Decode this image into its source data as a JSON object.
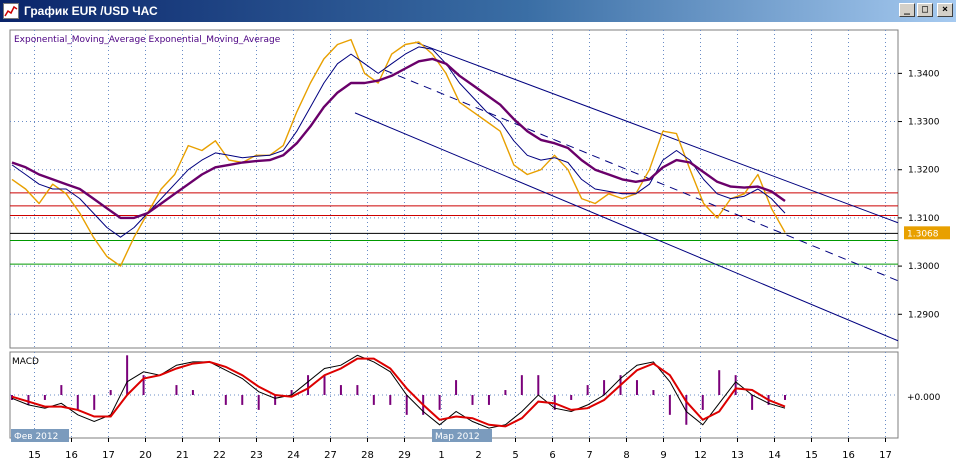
{
  "window": {
    "title": "График EUR /USD  ЧАС",
    "minimize_glyph": "_",
    "maximize_glyph": "□",
    "close_glyph": "×"
  },
  "indicators": {
    "legend": "Exponential_Moving_Average  Exponential_Moving_Average",
    "macd_label": "MACD",
    "macd_zero_label": "+0.000"
  },
  "current_price_label": "1.3068",
  "month_labels": [
    "Фев 2012",
    "Мар 2012"
  ],
  "colors": {
    "price": "#e8a000",
    "ema_fast": "#00007f",
    "ema_slow": "#6a006a",
    "channel": "#00007f",
    "resistance": "#cc0000",
    "support": "#009900",
    "current_line": "#000000",
    "macd_main": "#000000",
    "macd_signal": "#dd0000",
    "macd_hist": "#7a007a",
    "grid": "#6a8cc6"
  },
  "chart_data": {
    "type": "line",
    "y_tick_labels": [
      "1.3400",
      "1.3300",
      "1.3200",
      "1.3100",
      "1.3000",
      "1.2900"
    ],
    "y_ticks": [
      1.34,
      1.33,
      1.32,
      1.31,
      1.3,
      1.29
    ],
    "ylim": [
      1.283,
      1.349
    ],
    "x_tick_labels": [
      "15",
      "16",
      "17",
      "20",
      "21",
      "22",
      "23",
      "24",
      "27",
      "28",
      "29",
      "1",
      "2",
      "5",
      "6",
      "7",
      "8",
      "9",
      "12",
      "13",
      "14",
      "15",
      "16",
      "17"
    ],
    "horizontal_levels": {
      "resistance": [
        1.3152,
        1.3125,
        1.3105
      ],
      "current": 1.3068,
      "support": [
        1.3053,
        1.3004
      ]
    },
    "series": [
      {
        "values": [
          1.318,
          1.316,
          1.313,
          1.317,
          1.315,
          1.311,
          1.306,
          1.302,
          1.3,
          1.306,
          1.311,
          1.316,
          1.319,
          1.325,
          1.324,
          1.326,
          1.322,
          1.3215,
          1.323,
          1.323,
          1.325,
          1.332,
          1.338,
          1.343,
          1.346,
          1.347,
          1.34,
          1.338,
          1.344,
          1.346,
          1.3465,
          1.344,
          1.34,
          1.334,
          1.332,
          1.33,
          1.328,
          1.321,
          1.319,
          1.32,
          1.323,
          1.32,
          1.314,
          1.313,
          1.315,
          1.314,
          1.315,
          1.32,
          1.328,
          1.3275,
          1.32,
          1.313,
          1.31,
          1.314,
          1.315,
          1.319,
          1.312,
          1.307
        ]
      },
      {
        "values": [
          1.321,
          1.319,
          1.317,
          1.316,
          1.316,
          1.314,
          1.311,
          1.308,
          1.306,
          1.308,
          1.311,
          1.314,
          1.317,
          1.32,
          1.322,
          1.3235,
          1.323,
          1.3225,
          1.3228,
          1.323,
          1.324,
          1.328,
          1.333,
          1.338,
          1.342,
          1.344,
          1.342,
          1.34,
          1.342,
          1.344,
          1.3455,
          1.345,
          1.342,
          1.338,
          1.335,
          1.332,
          1.33,
          1.326,
          1.323,
          1.322,
          1.3225,
          1.3215,
          1.318,
          1.316,
          1.3155,
          1.315,
          1.315,
          1.317,
          1.322,
          1.324,
          1.322,
          1.318,
          1.315,
          1.314,
          1.3145,
          1.316,
          1.314,
          1.311
        ]
      },
      {
        "values": [
          1.3215,
          1.3205,
          1.319,
          1.318,
          1.317,
          1.316,
          1.314,
          1.312,
          1.31,
          1.31,
          1.311,
          1.313,
          1.315,
          1.317,
          1.319,
          1.3205,
          1.321,
          1.3215,
          1.3218,
          1.322,
          1.323,
          1.3255,
          1.329,
          1.333,
          1.336,
          1.338,
          1.338,
          1.3385,
          1.3395,
          1.341,
          1.3425,
          1.343,
          1.342,
          1.3395,
          1.3375,
          1.3355,
          1.3335,
          1.3305,
          1.328,
          1.3262,
          1.3255,
          1.3245,
          1.322,
          1.32,
          1.319,
          1.318,
          1.3175,
          1.318,
          1.3205,
          1.322,
          1.3215,
          1.3195,
          1.3175,
          1.3165,
          1.3163,
          1.3165,
          1.3155,
          1.3135
        ]
      }
    ],
    "channel_upper": [
      [
        1.3465,
        1.309
      ]
    ],
    "channel_lower": [
      [
        1.3318,
        1.2845
      ]
    ],
    "macd_main": [
      -0.0002,
      -0.0006,
      -0.0008,
      -0.0005,
      -0.0012,
      -0.0016,
      -0.0012,
      0.0008,
      0.0014,
      0.0012,
      0.0018,
      0.002,
      0.002,
      0.0015,
      0.001,
      0.0002,
      -0.0002,
      0.0,
      0.0008,
      0.0016,
      0.0018,
      0.0024,
      0.002,
      0.0014,
      0.0,
      -0.001,
      -0.0018,
      -0.001,
      -0.0016,
      -0.002,
      -0.0018,
      -0.001,
      0.0,
      -0.0008,
      -0.001,
      -0.0006,
      0.0,
      0.001,
      0.0018,
      0.002,
      0.0008,
      -0.001,
      -0.0018,
      -0.0005,
      0.0008,
      0.0,
      -0.0005,
      -0.0008
    ],
    "macd_signal": [
      -0.0001,
      -0.0004,
      -0.0007,
      -0.0007,
      -0.0009,
      -0.0013,
      -0.0013,
      0.0,
      0.001,
      0.0012,
      0.0016,
      0.0019,
      0.002,
      0.0017,
      0.0012,
      0.0005,
      0.0,
      -0.0001,
      0.0004,
      0.0012,
      0.0016,
      0.0022,
      0.0022,
      0.0016,
      0.0004,
      -0.0006,
      -0.0015,
      -0.0013,
      -0.0014,
      -0.0018,
      -0.0019,
      -0.0014,
      -0.0004,
      -0.0005,
      -0.0009,
      -0.0008,
      -0.0003,
      0.0006,
      0.0015,
      0.0019,
      0.0012,
      -0.0004,
      -0.0015,
      -0.001,
      0.0004,
      0.0003,
      -0.0003,
      -0.0007
    ],
    "macd_ylim": [
      -0.0026,
      0.0026
    ],
    "legend": "top-left",
    "grid": true
  }
}
